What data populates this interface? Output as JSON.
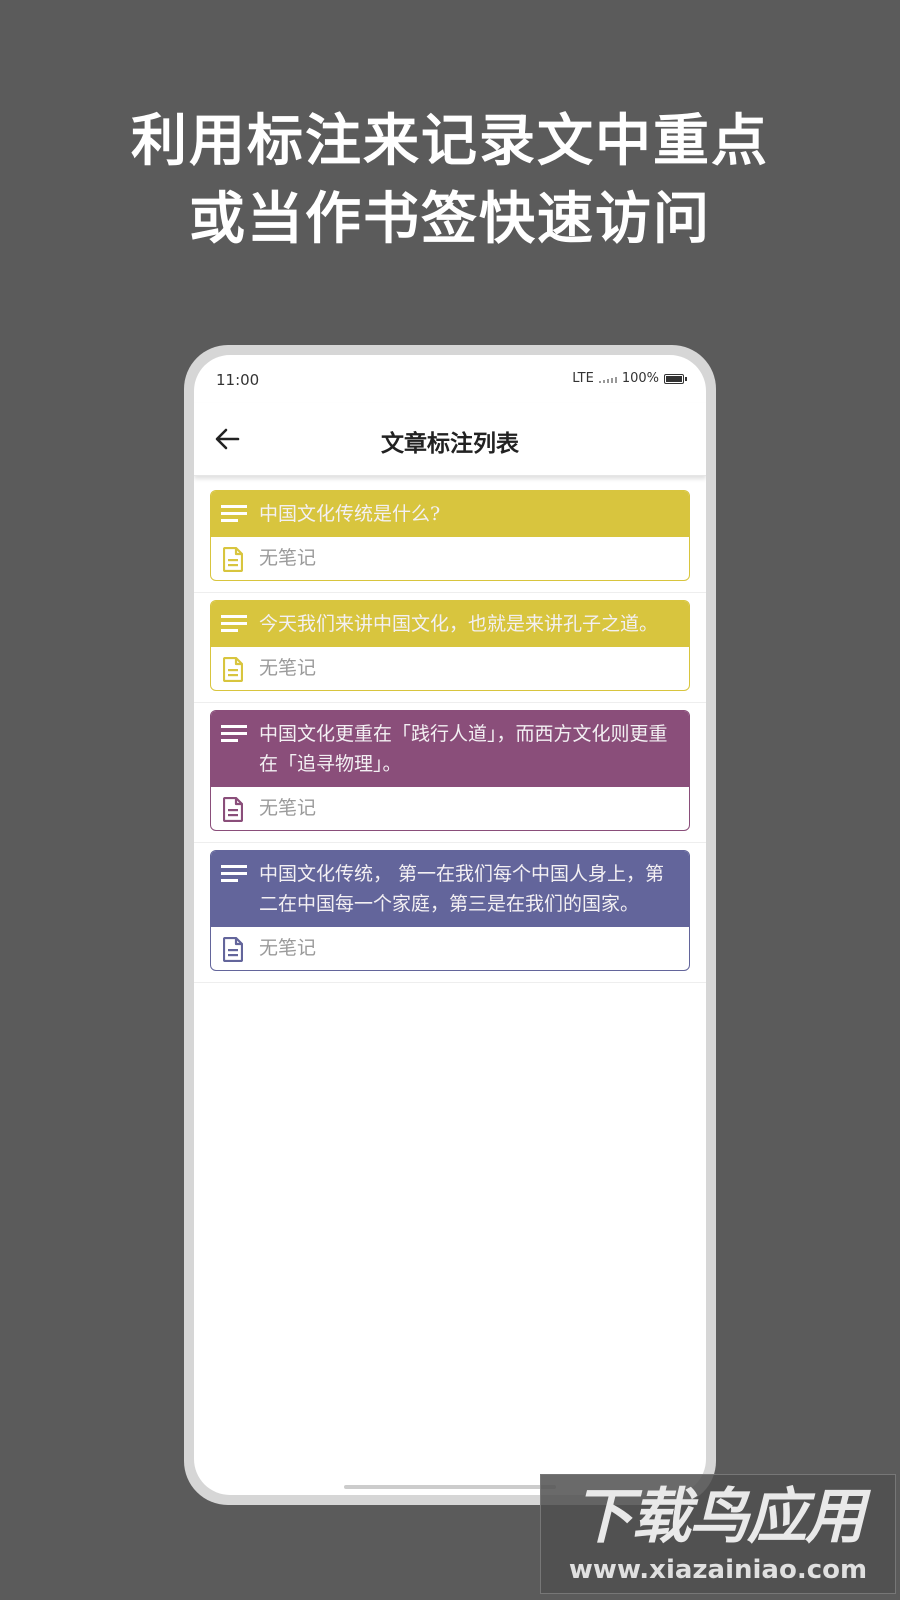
{
  "promo": {
    "line1": "利用标注来记录文中重点",
    "line2": "或当作书签快速访问"
  },
  "status_bar": {
    "time": "11:00",
    "network": "LTE",
    "battery": "100%"
  },
  "app_bar": {
    "back_icon": "arrow-left-icon",
    "title": "文章标注列表"
  },
  "annotations": [
    {
      "text": "中国文化传统是什么?",
      "note": "无笔记",
      "color": "#d8c53e"
    },
    {
      "text": "今天我们来讲中国文化，也就是来讲孔子之道。",
      "note": "无笔记",
      "color": "#d8c53e"
    },
    {
      "text": "中国文化更重在「践行人道」，而西方文化则更重在「追寻物理」。",
      "note": "无笔记",
      "color": "#8a4e7a"
    },
    {
      "text": "中国文化传统， 第一在我们每个中国人身上，第二在中国每一个家庭，第三是在我们的国家。",
      "note": "无笔记",
      "color": "#63659b"
    }
  ],
  "watermark": {
    "title": "下载鸟应用",
    "url": "www.xiazainiao.com"
  }
}
